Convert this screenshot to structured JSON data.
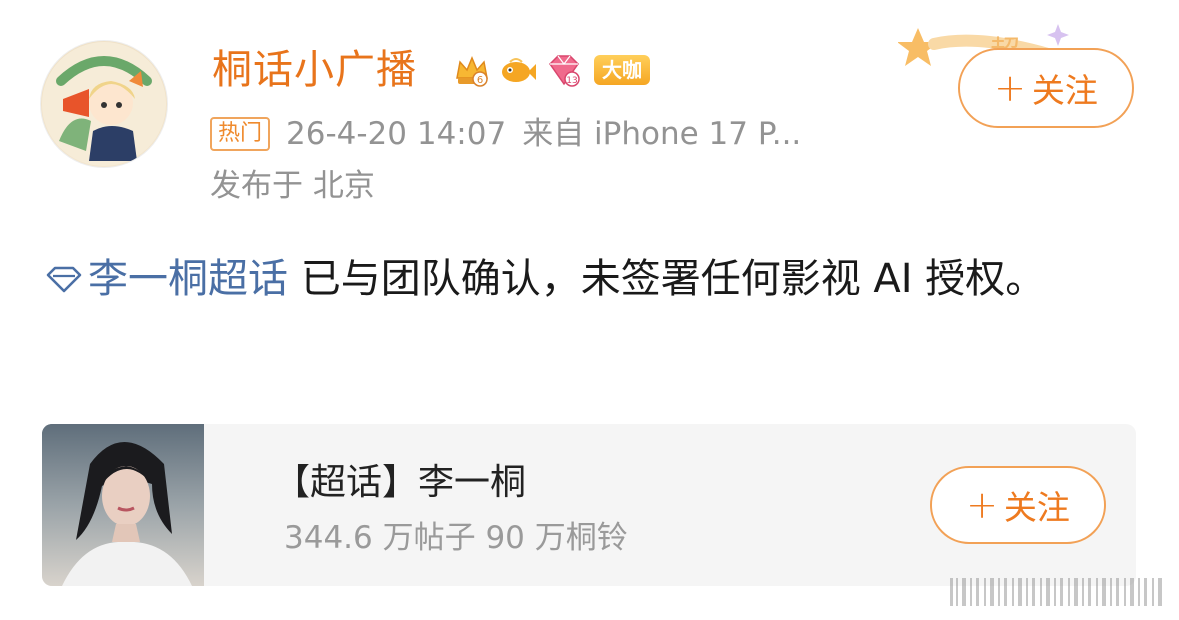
{
  "user": {
    "name": "桐话小广播",
    "badges": {
      "crown_level": "6",
      "gem_level": "13",
      "dakai_label": "大咖"
    }
  },
  "meta": {
    "hot_tag": "热门",
    "timestamp": "26-4-20 14:07",
    "source": "来自 iPhone 17 P...",
    "location": "发布于 北京"
  },
  "follow_label": "关注",
  "follow_plus": "+",
  "deco_text": "超",
  "post": {
    "topic": "李一桐超话",
    "body": " 已与团队确认，未签署任何影视 AI 授权。"
  },
  "card": {
    "title": "【超话】李一桐",
    "stats": "344.6 万帖子  90 万桐铃"
  },
  "colors": {
    "username": "#e8741b",
    "accent": "#ee7a1f",
    "link": "#4a6fa5",
    "meta": "#939393"
  },
  "icons": {
    "topic": "diamond-topic-icon",
    "crown": "crown-badge-icon",
    "fish": "fish-badge-icon",
    "gem": "gem-badge-icon"
  }
}
